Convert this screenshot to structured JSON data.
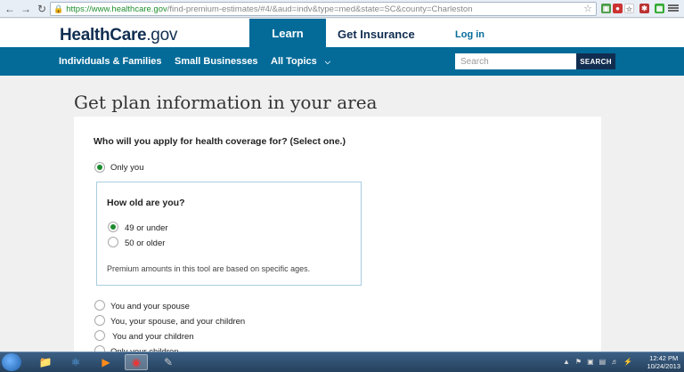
{
  "browser": {
    "url_scheme": "https://",
    "url_host": "www.healthcare.gov",
    "url_path": "/find-premium-estimates/#4/&aud=indv&type=med&state=SC&county=Charleston",
    "back_icon": "back-arrow-icon",
    "forward_icon": "forward-arrow-icon",
    "reload_icon": "reload-icon"
  },
  "header": {
    "logo_main": "HealthCare",
    "logo_suffix": ".gov",
    "learn": "Learn",
    "get_insurance": "Get Insurance",
    "login": "Log in"
  },
  "nav": {
    "items": [
      "Individuals & Families",
      "Small Businesses",
      "All Topics"
    ],
    "all_topics_chevron": "chevron-down-icon",
    "search_placeholder": "Search",
    "search_button": "SEARCH"
  },
  "page": {
    "title": "Get plan information in your area",
    "question": "Who will you apply for health coverage for? (Select one.)",
    "options": [
      {
        "label": "Only you",
        "selected": true
      },
      {
        "label": "You and your spouse",
        "selected": false
      },
      {
        "label": "You, your spouse, and your children",
        "selected": false
      },
      {
        "label": "You and your children",
        "selected": false
      },
      {
        "label": "Only your children",
        "selected": false
      }
    ],
    "age_question": "How old are you?",
    "age_options": [
      {
        "label": "49 or under",
        "selected": true
      },
      {
        "label": "50 or older",
        "selected": false
      }
    ],
    "age_note": "Premium amounts in this tool are based on specific ages."
  },
  "taskbar": {
    "time": "12:42 PM",
    "date": "10/24/2013"
  },
  "colors": {
    "brand_blue": "#046b99",
    "navy": "#112e51",
    "selected_green": "#1d8b2f"
  }
}
